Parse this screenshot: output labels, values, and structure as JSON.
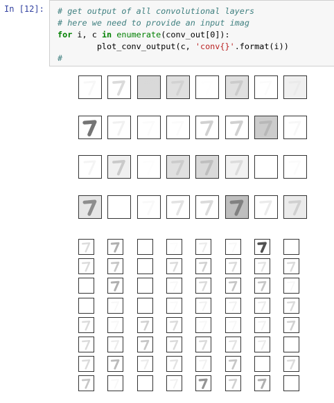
{
  "prompt": "In [12]:",
  "code": {
    "comment1": "# get output of all convolutional layers",
    "comment2": "# here we need to provide an input imag",
    "for_kw": "for",
    "loop_vars": " i, c ",
    "in_kw": "in",
    "enumerate_fn": "enumerate",
    "enumerate_args": "(conv_out[0]):",
    "indent": "        ",
    "call": "plot_conv_output(c, ",
    "str_literal": "'conv{}'",
    "call_end": ".format(i))",
    "comment3": "#"
  },
  "output": {
    "conv0_levels": [
      0.1,
      0.3,
      0.15,
      0.25,
      0.02,
      0.3,
      0.05,
      0.12,
      0.7,
      0.15,
      0.05,
      0.05,
      0.35,
      0.35,
      0.35,
      0.1,
      0.12,
      0.35,
      0.03,
      0.3,
      0.35,
      0.25,
      0.0,
      0.05,
      0.6,
      0.0,
      0.08,
      0.25,
      0.3,
      0.6,
      0.2,
      0.3
    ],
    "conv0_bg": [
      0.0,
      0.0,
      0.15,
      0.12,
      0.0,
      0.12,
      0.0,
      0.06,
      0.0,
      0.0,
      0.0,
      0.0,
      0.0,
      0.0,
      0.2,
      0.0,
      0.0,
      0.06,
      0.0,
      0.12,
      0.15,
      0.05,
      0.0,
      0.0,
      0.1,
      0.0,
      0.0,
      0.0,
      0.0,
      0.25,
      0.0,
      0.08
    ],
    "conv1_levels": [
      0.3,
      0.5,
      0.0,
      0.05,
      0.2,
      0.1,
      0.8,
      0.0,
      0.3,
      0.4,
      0.0,
      0.3,
      0.35,
      0.3,
      0.25,
      0.3,
      0.0,
      0.5,
      0.0,
      0.1,
      0.3,
      0.4,
      0.4,
      0.1,
      0.0,
      0.1,
      0.0,
      0.08,
      0.15,
      0.15,
      0.2,
      0.3,
      0.3,
      0.1,
      0.35,
      0.3,
      0.1,
      0.1,
      0.15,
      0.35,
      0.3,
      0.2,
      0.4,
      0.3,
      0.3,
      0.25,
      0.2,
      0.0,
      0.3,
      0.45,
      0.2,
      0.25,
      0.15,
      0.4,
      0.0,
      0.3,
      0.4,
      0.1,
      0.0,
      0.15,
      0.6,
      0.35,
      0.5,
      0.0
    ]
  }
}
